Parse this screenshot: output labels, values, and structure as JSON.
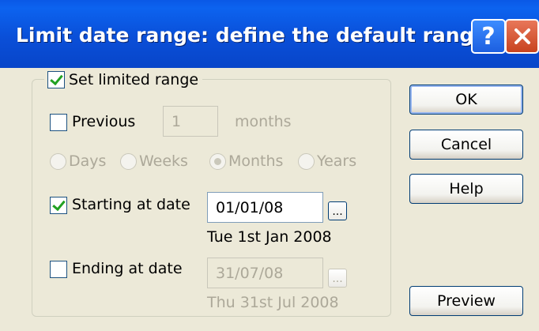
{
  "window": {
    "title": "Limit date range: define the default range",
    "help_button": "?",
    "close_button": "✕"
  },
  "group": {
    "set_limited_range": {
      "label": "Set limited range",
      "checked": true
    }
  },
  "previous": {
    "label": "Previous",
    "checked": false,
    "value": "1",
    "unit": "months"
  },
  "period_options": [
    {
      "label": "Days",
      "selected": false
    },
    {
      "label": "Weeks",
      "selected": false
    },
    {
      "label": "Months",
      "selected": true
    },
    {
      "label": "Years",
      "selected": false
    }
  ],
  "starting": {
    "label": "Starting at date",
    "checked": true,
    "value": "01/01/08",
    "caption": "Tue 1st Jan 2008",
    "browse": "..."
  },
  "ending": {
    "label": "Ending at date",
    "checked": false,
    "value": "31/07/08",
    "caption": "Thu 31st Jul 2008",
    "browse": "..."
  },
  "buttons": {
    "ok": "OK",
    "cancel": "Cancel",
    "help": "Help",
    "preview": "Preview"
  }
}
